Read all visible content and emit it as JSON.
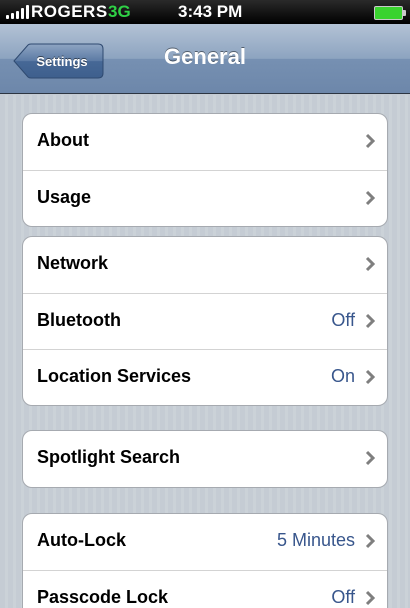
{
  "status_bar": {
    "carrier": "ROGERS",
    "network": "3G",
    "time": "3:43 PM",
    "signal_icon": "signal-bars-icon",
    "battery_icon": "battery-icon",
    "battery_level": 1.0
  },
  "nav": {
    "back_label": "Settings",
    "title": "General"
  },
  "groups": [
    {
      "rows": [
        {
          "label": "About",
          "value": ""
        },
        {
          "label": "Usage",
          "value": ""
        }
      ]
    },
    {
      "rows": [
        {
          "label": "Network",
          "value": ""
        },
        {
          "label": "Bluetooth",
          "value": "Off"
        },
        {
          "label": "Location Services",
          "value": "On"
        }
      ]
    },
    {
      "rows": [
        {
          "label": "Spotlight Search",
          "value": ""
        }
      ]
    },
    {
      "rows": [
        {
          "label": "Auto-Lock",
          "value": "5 Minutes"
        },
        {
          "label": "Passcode Lock",
          "value": "Off"
        }
      ]
    }
  ],
  "colors": {
    "nav_bar": "#7690b2",
    "value_text": "#38568c",
    "network_3g": "#2fd146",
    "battery": "#3ad32f",
    "background": "#c5ccd4"
  }
}
